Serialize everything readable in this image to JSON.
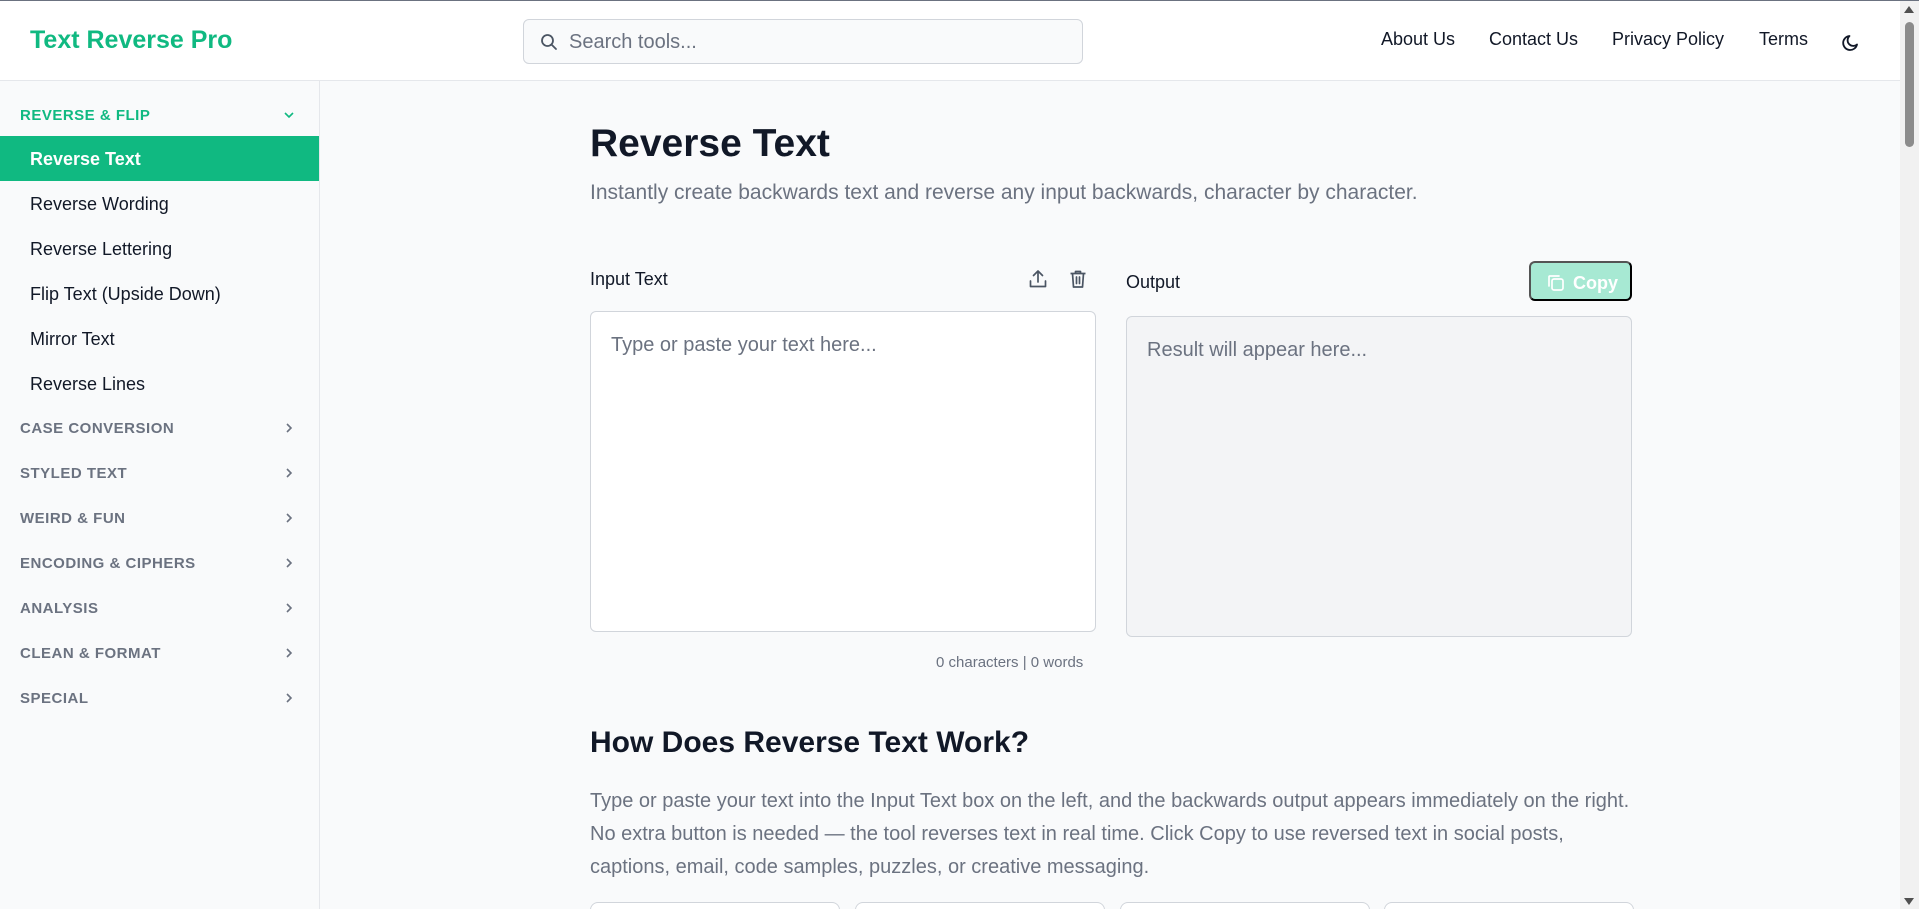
{
  "header": {
    "logo": "Text Reverse Pro",
    "search_placeholder": "Search tools...",
    "nav": [
      "About Us",
      "Contact Us",
      "Privacy Policy",
      "Terms"
    ],
    "theme_icon": "moon-icon"
  },
  "sidebar": {
    "open_category": "REVERSE & FLIP",
    "items": [
      "Reverse Text",
      "Reverse Wording",
      "Reverse Lettering",
      "Flip Text (Upside Down)",
      "Mirror Text",
      "Reverse Lines"
    ],
    "active_item": "Reverse Text",
    "categories": [
      "CASE CONVERSION",
      "STYLED TEXT",
      "WEIRD & FUN",
      "ENCODING & CIPHERS",
      "ANALYSIS",
      "CLEAN & FORMAT",
      "SPECIAL"
    ]
  },
  "main": {
    "title": "Reverse Text",
    "subtitle": "Instantly create backwards text and reverse any input backwards, character by character.",
    "input_label": "Input Text",
    "input_placeholder": "Type or paste your text here...",
    "output_label": "Output",
    "output_placeholder": "Result will appear here...",
    "copy_label": "Copy",
    "counts": "0 characters | 0 words",
    "how_title": "How Does Reverse Text Work?",
    "how_text": "Type or paste your text into the Input Text box on the left, and the backwards output appears immediately on the right. No extra button is needed — the tool reverses text in real time. Click Copy to use reversed text in social posts, captions, email, code samples, puzzles, or creative messaging."
  },
  "colors": {
    "accent": "#10b981",
    "accent_disabled": "#a7e9d3",
    "muted_text": "#6b7280",
    "text": "#111827"
  }
}
